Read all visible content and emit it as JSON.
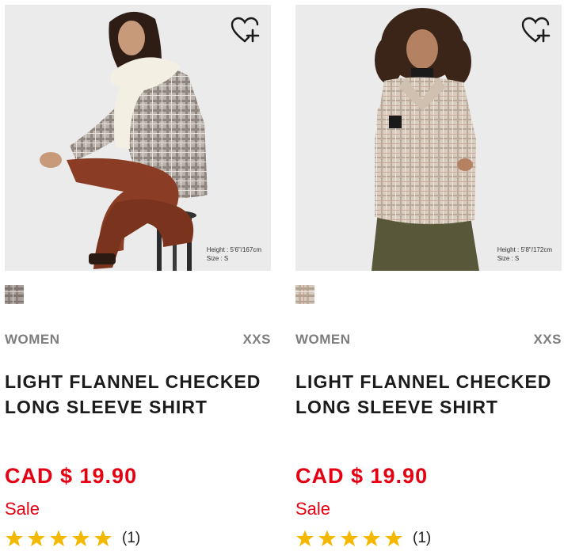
{
  "products": [
    {
      "model_height": "Height : 5'6\"/167cm",
      "model_size": "Size : S",
      "gender": "WOMEN",
      "size_range": "XXS",
      "name_line1": "LIGHT FLANNEL CHECKED",
      "name_line2": "LONG SLEEVE SHIRT",
      "price": "CAD $ 19.90",
      "sale_label": "Sale",
      "rating_value": 5,
      "rating_count": "(1)",
      "wishlist_icon": "heart-plus-icon",
      "swatch_color": "#a9a09a"
    },
    {
      "model_height": "Height : 5'8\"/172cm",
      "model_size": "Size : S",
      "gender": "WOMEN",
      "size_range": "XXS",
      "name_line1": "LIGHT FLANNEL CHECKED",
      "name_line2": "LONG SLEEVE SHIRT",
      "price": "CAD $ 19.90",
      "sale_label": "Sale",
      "rating_value": 5,
      "rating_count": "(1)",
      "wishlist_icon": "heart-plus-icon",
      "swatch_color": "#d8cbbd"
    }
  ],
  "colors": {
    "price_red": "#e60012",
    "star_gold": "#f5b800",
    "meta_gray": "#7d7d7d"
  }
}
